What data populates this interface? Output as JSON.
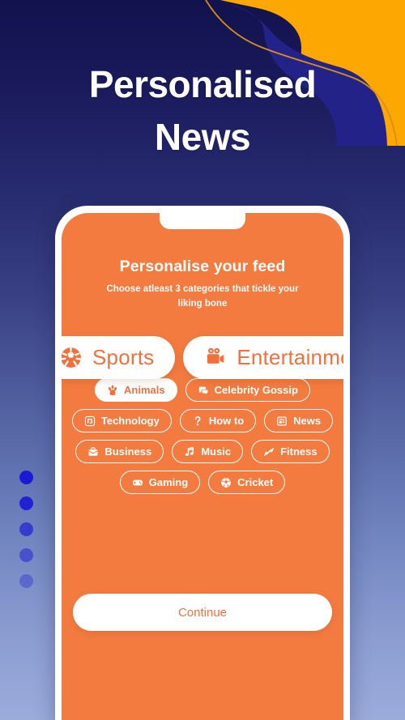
{
  "headline": {
    "line1": "Personalised",
    "line2": "News"
  },
  "colors": {
    "orange": "#F47B40",
    "orange_text": "#F2713A",
    "accent_yellow": "#FDA802",
    "deep_blue": "#232288",
    "gold_line": "#D89018",
    "dot_blue": "#1A1AD6",
    "bg_top": "#12124E",
    "bg_bottom": "#9BACDB",
    "white": "#FFFFFF"
  },
  "pagination": {
    "count": 5,
    "active_index": 0
  },
  "phone": {
    "screen": {
      "title": "Personalise your feed",
      "subtitle": "Choose atleast 3 categories that tickle your liking bone",
      "featured": [
        {
          "label": "Sports",
          "icon": "soccer-ball-icon",
          "selected": true
        },
        {
          "label": "Entertainment",
          "icon": "movie-camera-icon",
          "selected": true
        }
      ],
      "chip_rows": [
        [
          {
            "label": "Animals",
            "icon": "paw-icon",
            "selected": true
          },
          {
            "label": "Celebrity Gossip",
            "icon": "chat-bubbles-icon",
            "selected": false
          }
        ],
        [
          {
            "label": "Technology",
            "icon": "microchip-icon",
            "selected": false
          },
          {
            "label": "How to",
            "icon": "question-mark-icon",
            "selected": false
          },
          {
            "label": "News",
            "icon": "newspaper-icon",
            "selected": false
          }
        ],
        [
          {
            "label": "Business",
            "icon": "briefcase-icon",
            "selected": false
          },
          {
            "label": "Music",
            "icon": "music-note-icon",
            "selected": false
          },
          {
            "label": "Fitness",
            "icon": "dumbbell-icon",
            "selected": false
          }
        ],
        [
          {
            "label": "Gaming",
            "icon": "gamepad-icon",
            "selected": false
          },
          {
            "label": "Cricket",
            "icon": "cricket-ball-icon",
            "selected": false
          }
        ]
      ],
      "continue_label": "Continue"
    }
  }
}
